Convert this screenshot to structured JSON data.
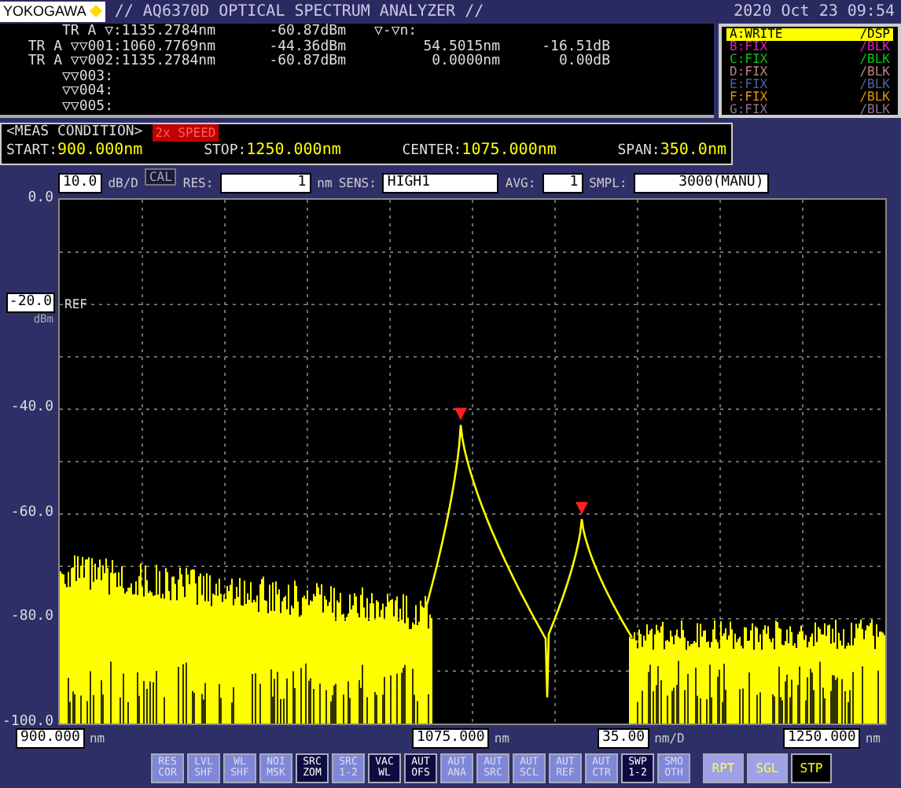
{
  "header": {
    "brand": "YOKOGAWA",
    "title": "// AQ6370D OPTICAL SPECTRUM ANALYZER //",
    "datetime": "2020 Oct 23 09:54"
  },
  "markers": [
    {
      "label": "TR A ▽",
      "wavelength": ":1135.2784nm",
      "level": "-60.87dBm"
    },
    {
      "label": "TR A ▽▽001",
      "wavelength": ":1060.7769nm",
      "level": "-44.36dBm"
    },
    {
      "label": "TR A ▽▽002",
      "wavelength": ":1135.2784nm",
      "level": "-60.87dBm"
    },
    {
      "label": "▽▽003:"
    },
    {
      "label": "▽▽004:"
    },
    {
      "label": "▽▽005:"
    }
  ],
  "delta": {
    "title": "▽-▽n:",
    "rows": [
      {
        "wavelength": "54.5015nm",
        "level": "-16.51dB"
      },
      {
        "wavelength": "0.0000nm",
        "level": "0.00dB"
      }
    ]
  },
  "traces": [
    {
      "name": "A:WRITE",
      "mode": "/DSP",
      "color": "#ffff00",
      "selected": true
    },
    {
      "name": "B:FIX",
      "mode": "/BLK",
      "color": "#e020c0",
      "selected": false
    },
    {
      "name": "C:FIX",
      "mode": "/BLK",
      "color": "#10c010",
      "selected": false
    },
    {
      "name": "D:FIX",
      "mode": "/BLK",
      "color": "#c08080",
      "selected": false
    },
    {
      "name": "E:FIX",
      "mode": "/BLK",
      "color": "#5060a0",
      "selected": false
    },
    {
      "name": "F:FIX",
      "mode": "/BLK",
      "color": "#e09010",
      "selected": false
    },
    {
      "name": "G:FIX",
      "mode": "/BLK",
      "color": "#907090",
      "selected": false
    }
  ],
  "condition": {
    "title": "<MEAS CONDITION>",
    "badge": "2x SPEED",
    "fields": [
      {
        "label": "START:",
        "value": "900.000nm"
      },
      {
        "label": "STOP:",
        "value": "1250.000nm"
      },
      {
        "label": "CENTER:",
        "value": "1075.000nm"
      },
      {
        "label": "SPAN:",
        "value": "350.0nm"
      }
    ]
  },
  "settings": {
    "scale": "10.0",
    "scale_unit": "dB/D",
    "cal": "CAL",
    "res": {
      "label": "RES:",
      "value": "1",
      "unit": "nm"
    },
    "sens": {
      "label": "SENS:",
      "value": "HIGH1"
    },
    "avg": {
      "label": "AVG:",
      "value": "1"
    },
    "smpl": {
      "label": "SMPL:",
      "value": "3000(MANU)"
    }
  },
  "y_axis": {
    "labels": [
      "0.0",
      "-40.0",
      "-60.0",
      "-80.0",
      "-100.0"
    ],
    "ref": "-20.0",
    "ref_label": "REF",
    "ref_unit": "dBm"
  },
  "x_axis": [
    {
      "value": "900.000",
      "unit": "nm"
    },
    {
      "value": "1075.000",
      "unit": "nm"
    },
    {
      "value": "35.00",
      "unit": "nm/D"
    },
    {
      "value": "1250.000",
      "unit": "nm"
    }
  ],
  "buttons": [
    {
      "label": "RES COR",
      "on": false
    },
    {
      "label": "LVL SHF",
      "on": false
    },
    {
      "label": "WL SHF",
      "on": false
    },
    {
      "label": "NOI MSK",
      "on": false
    },
    {
      "label": "SRC ZOM",
      "on": true
    },
    {
      "label": "SRC 1-2",
      "on": false
    },
    {
      "label": "VAC WL",
      "on": true
    },
    {
      "label": "AUT OFS",
      "on": true
    },
    {
      "label": "AUT ANA",
      "on": false
    },
    {
      "label": "AUT SRC",
      "on": false
    },
    {
      "label": "AUT SCL",
      "on": false
    },
    {
      "label": "AUT REF",
      "on": false
    },
    {
      "label": "AUT CTR",
      "on": false
    },
    {
      "label": "SWP 1-2",
      "on": true
    },
    {
      "label": "SMO OTH",
      "on": false
    }
  ],
  "sweep": [
    {
      "label": "RPT",
      "selected": false
    },
    {
      "label": "SGL",
      "selected": false
    },
    {
      "label": "STP",
      "selected": true
    }
  ]
}
